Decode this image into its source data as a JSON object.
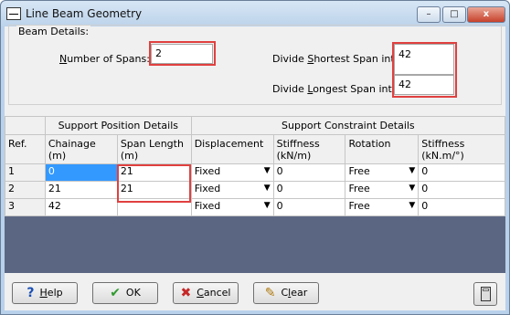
{
  "window": {
    "title": "Line Beam Geometry",
    "minimize_glyph": "–",
    "maximize_glyph": "□",
    "close_glyph": "x"
  },
  "beam_details": {
    "legend": "Beam Details:",
    "spans_label_u": "N",
    "spans_label_rest": "umber of Spans:",
    "spans_value": "2",
    "shortest_pre": "Divide ",
    "shortest_u": "S",
    "shortest_post": "hortest Span into:",
    "shortest_value": "42",
    "longest_pre": "Divide ",
    "longest_u": "L",
    "longest_post": "ongest Span into:",
    "longest_value": "42"
  },
  "grid": {
    "group_headers": [
      "Support Position Details",
      "Support Constraint Details"
    ],
    "columns": [
      "Ref.",
      "Chainage\n(m)",
      "Span Length\n(m)",
      "Displacement",
      "Stiffness\n(kN/m)",
      "Rotation",
      "Stiffness\n(kN.m/°)"
    ],
    "rows": [
      {
        "ref": "1",
        "chainage": "0",
        "span": "21",
        "displacement": "Fixed",
        "stiff1": "0",
        "rotation": "Free",
        "stiff2": "0"
      },
      {
        "ref": "2",
        "chainage": "21",
        "span": "21",
        "displacement": "Fixed",
        "stiff1": "0",
        "rotation": "Free",
        "stiff2": "0"
      },
      {
        "ref": "3",
        "chainage": "42",
        "span": "",
        "displacement": "Fixed",
        "stiff1": "0",
        "rotation": "Free",
        "stiff2": "0"
      }
    ],
    "dropdown_arrow": "▼"
  },
  "buttons": {
    "help_u": "H",
    "help_rest": "elp",
    "help_icon": "?",
    "ok": "OK",
    "ok_icon": "✔",
    "cancel_u": "C",
    "cancel_rest": "ancel",
    "cancel_icon": "✖",
    "clear_pre": "C",
    "clear_u": "l",
    "clear_rest": "ear",
    "clear_icon": "✎"
  },
  "colors": {
    "accent_highlight": "#e0403f",
    "selection": "#3399ff",
    "grid_background": "#5b6782"
  }
}
